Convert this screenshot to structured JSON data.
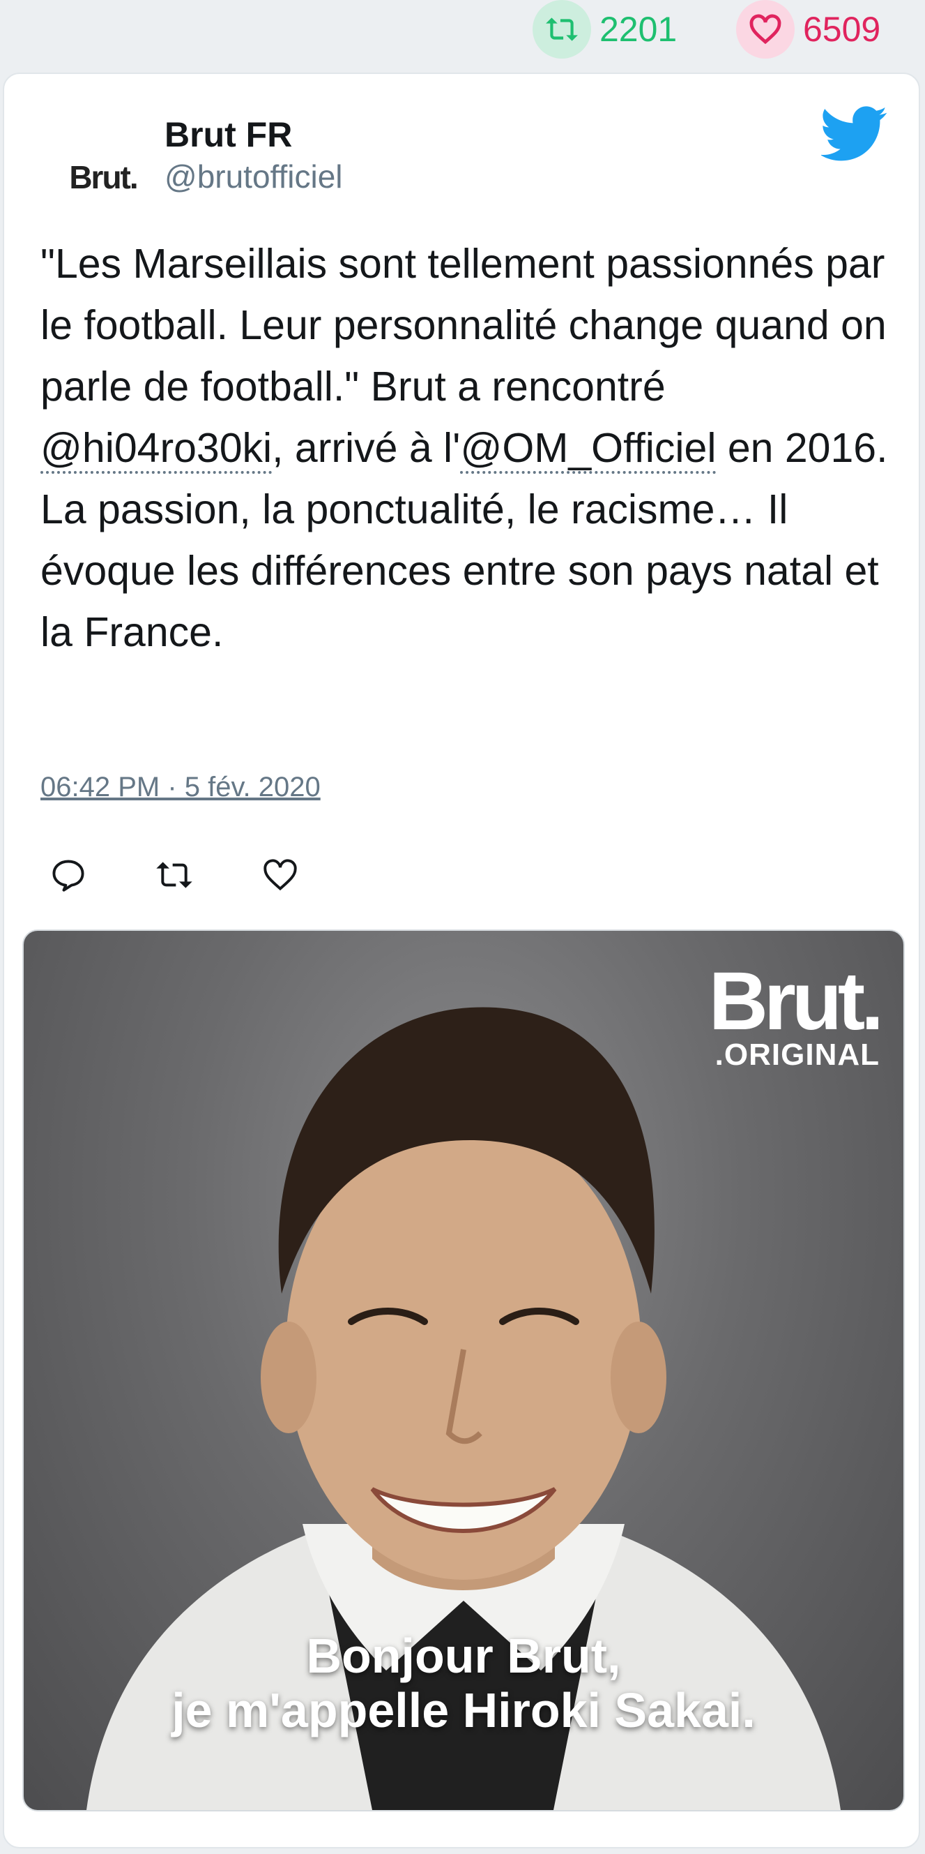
{
  "stats": {
    "retweets": "2201",
    "likes": "6509",
    "retweet_color": "#1ebf70",
    "like_color": "#e0245e"
  },
  "tweet": {
    "avatar_text": "Brut.",
    "name": "Brut FR",
    "handle": "@brutofficiel",
    "text_parts": {
      "p1": "\"Les Marseillais sont tellement passionnés par le football. Leur personnalité change quand on parle de football.\" Brut a rencontré ",
      "m1": "@hi04ro30ki",
      "p2": ", arrivé à l'",
      "m2": "@OM_Officiel",
      "p3": " en 2016. La passion, la ponctualité, le racisme… Il évoque les différences entre son pays natal et la France."
    },
    "timestamp": "06:42 PM · 5 fév. 2020",
    "icons": {
      "brand": "twitter-bird-icon",
      "reply": "reply-icon",
      "retweet": "retweet-icon",
      "like": "heart-icon"
    },
    "brand_color": "#1da1f2"
  },
  "media": {
    "logo_main": "Brut.",
    "logo_sub": ".ORIGINAL",
    "subtitle_line1": "Bonjour Brut,",
    "subtitle_line2": "je m'appelle Hiroki Sakai."
  }
}
